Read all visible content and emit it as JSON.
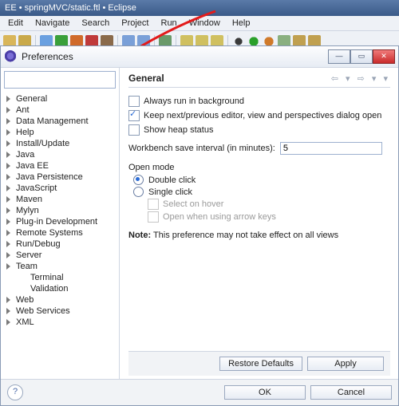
{
  "app": {
    "title": "EE • springMVC/static.ftl • Eclipse"
  },
  "menu": [
    "Edit",
    "Navigate",
    "Search",
    "Project",
    "Run",
    "Window",
    "Help"
  ],
  "dialog": {
    "title": "Preferences"
  },
  "filter": {
    "value": "",
    "placeholder": ""
  },
  "tree": [
    {
      "label": "General",
      "expand": true,
      "indent": 0
    },
    {
      "label": "Ant",
      "expand": true,
      "indent": 0
    },
    {
      "label": "Data Management",
      "expand": true,
      "indent": 0
    },
    {
      "label": "Help",
      "expand": true,
      "indent": 0
    },
    {
      "label": "Install/Update",
      "expand": true,
      "indent": 0
    },
    {
      "label": "Java",
      "expand": true,
      "indent": 0
    },
    {
      "label": "Java EE",
      "expand": true,
      "indent": 0
    },
    {
      "label": "Java Persistence",
      "expand": true,
      "indent": 0
    },
    {
      "label": "JavaScript",
      "expand": true,
      "indent": 0
    },
    {
      "label": "Maven",
      "expand": true,
      "indent": 0
    },
    {
      "label": "Mylyn",
      "expand": true,
      "indent": 0
    },
    {
      "label": "Plug-in Development",
      "expand": true,
      "indent": 0
    },
    {
      "label": "Remote Systems",
      "expand": true,
      "indent": 0
    },
    {
      "label": "Run/Debug",
      "expand": true,
      "indent": 0
    },
    {
      "label": "Server",
      "expand": true,
      "indent": 0
    },
    {
      "label": "Team",
      "expand": true,
      "indent": 0
    },
    {
      "label": "Terminal",
      "expand": false,
      "indent": 1
    },
    {
      "label": "Validation",
      "expand": false,
      "indent": 1
    },
    {
      "label": "Web",
      "expand": true,
      "indent": 0
    },
    {
      "label": "Web Services",
      "expand": true,
      "indent": 0
    },
    {
      "label": "XML",
      "expand": true,
      "indent": 0
    }
  ],
  "page": {
    "heading": "General",
    "always_bg": {
      "label": "Always run in background",
      "checked": false
    },
    "keep_editor": {
      "label": "Keep next/previous editor, view and perspectives dialog open",
      "checked": true
    },
    "heap": {
      "label": "Show heap status",
      "checked": false
    },
    "interval_label": "Workbench save interval (in minutes):",
    "interval_value": "5",
    "open_mode": {
      "legend": "Open mode",
      "double": "Double click",
      "single": "Single click",
      "selected": "double",
      "hover": "Select on hover",
      "arrow": "Open when using arrow keys"
    },
    "note_label": "Note:",
    "note_text": " This preference may not take effect on all views"
  },
  "buttons": {
    "restore": "Restore Defaults",
    "apply": "Apply",
    "ok": "OK",
    "cancel": "Cancel"
  }
}
